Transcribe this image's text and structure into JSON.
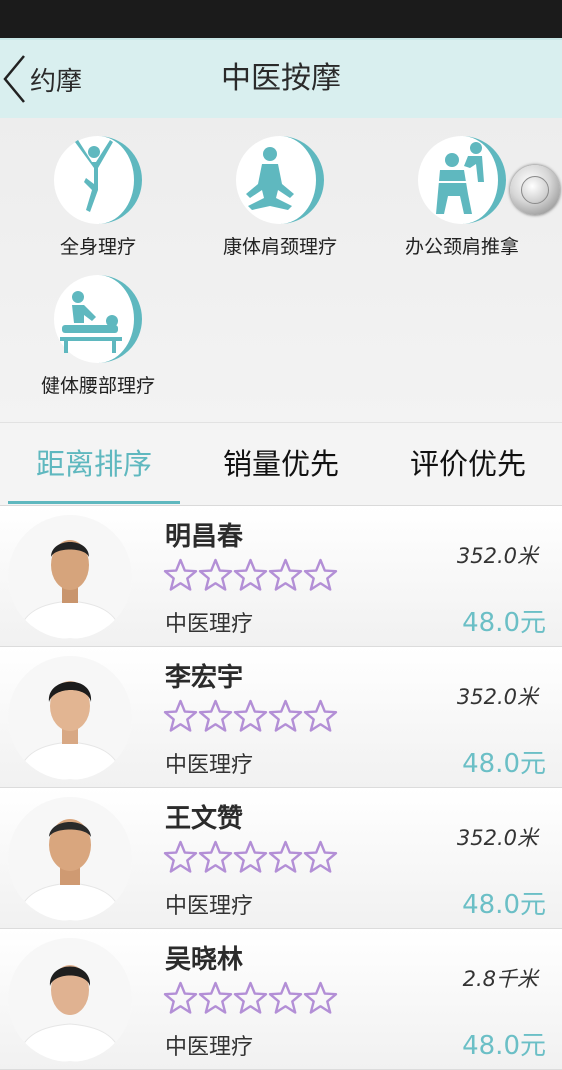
{
  "header": {
    "back_label": "约摩",
    "title": "中医按摩"
  },
  "categories": [
    {
      "label": "全身理疗",
      "icon": "person-yoga-icon"
    },
    {
      "label": "康体肩颈理疗",
      "icon": "person-meditation-icon"
    },
    {
      "label": "办公颈肩推拿",
      "icon": "person-massage-shoulder-icon"
    },
    {
      "label": "健体腰部理疗",
      "icon": "person-massage-back-icon"
    }
  ],
  "tabs": [
    {
      "label": "距离排序",
      "active": true
    },
    {
      "label": "销量优先",
      "active": false
    },
    {
      "label": "评价优先",
      "active": false
    }
  ],
  "therapists": [
    {
      "name": "明昌春",
      "category": "中医理疗",
      "distance": "352.0米",
      "price": "48.0元",
      "rating": 0
    },
    {
      "name": "李宏宇",
      "category": "中医理疗",
      "distance": "352.0米",
      "price": "48.0元",
      "rating": 0
    },
    {
      "name": "王文赞",
      "category": "中医理疗",
      "distance": "352.0米",
      "price": "48.0元",
      "rating": 0
    },
    {
      "name": "吴晓林",
      "category": "中医理疗",
      "distance": "2.8千米",
      "price": "48.0元",
      "rating": 0
    }
  ],
  "colors": {
    "accent": "#5fb8bf",
    "star": "#b38fd6",
    "header_bg": "#d9efef",
    "price": "#6bbfc6"
  }
}
